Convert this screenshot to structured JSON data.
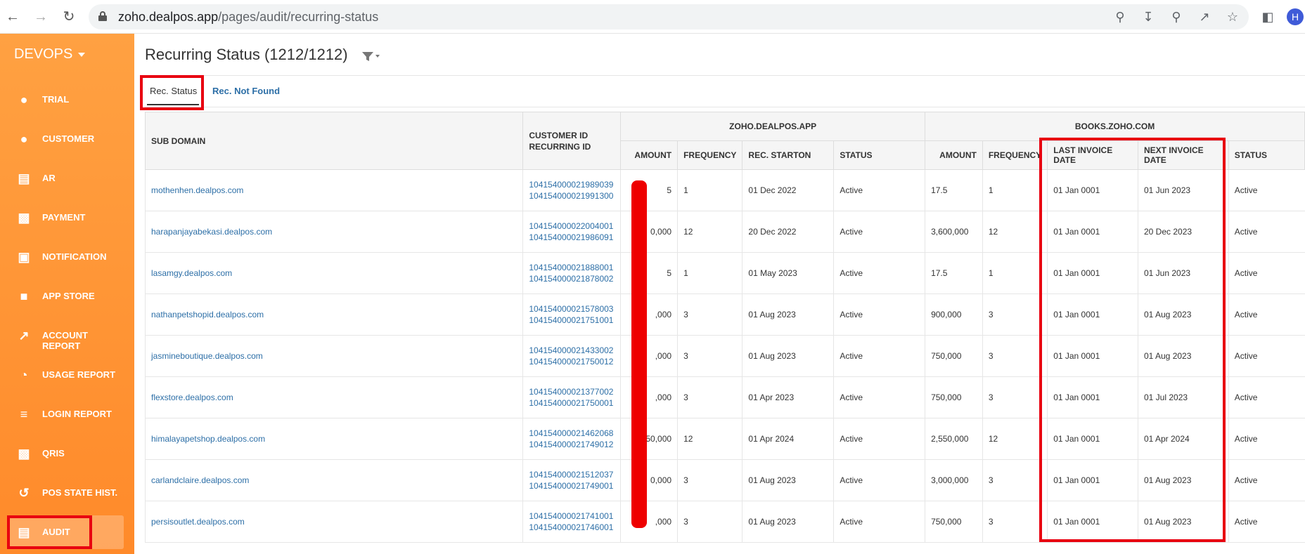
{
  "browser": {
    "url_domain": "zoho.dealpos.app",
    "url_path": "/pages/audit/recurring-status",
    "profile_initial": "H"
  },
  "sidebar": {
    "brand": "DEVOPS",
    "items": [
      {
        "label": "TRIAL",
        "icon": "person-icon"
      },
      {
        "label": "CUSTOMER",
        "icon": "person-icon"
      },
      {
        "label": "AR",
        "icon": "document-icon"
      },
      {
        "label": "PAYMENT",
        "icon": "money-icon"
      },
      {
        "label": "NOTIFICATION",
        "icon": "inbox-icon"
      },
      {
        "label": "APP STORE",
        "icon": "store-icon"
      },
      {
        "label": "ACCOUNT REPORT",
        "icon": "line-chart-icon"
      },
      {
        "label": "USAGE REPORT",
        "icon": "pie-chart-icon"
      },
      {
        "label": "LOGIN REPORT",
        "icon": "list-chart-icon"
      },
      {
        "label": "QRIS",
        "icon": "money-icon"
      },
      {
        "label": "POS STATE HIST.",
        "icon": "history-icon"
      },
      {
        "label": "AUDIT",
        "icon": "book-icon"
      }
    ],
    "active_item": "AUDIT"
  },
  "page": {
    "title": "Recurring Status (1212/1212)",
    "tabs": [
      {
        "label": "Rec. Status",
        "active": true
      },
      {
        "label": "Rec. Not Found",
        "active": false
      }
    ]
  },
  "table": {
    "group_headers": {
      "zoho": "ZOHO.DEALPOS.APP",
      "books": "BOOKS.ZOHO.COM"
    },
    "headers": {
      "sub_domain": "SUB DOMAIN",
      "customer_id": "CUSTOMER ID",
      "recurring_id": "RECURRING ID",
      "amount": "AMOUNT",
      "frequency": "FREQUENCY",
      "rec_starton": "REC. STARTON",
      "status": "STATUS",
      "books_amount": "AMOUNT",
      "books_frequency": "FREQUENCY",
      "last_invoice_date": "LAST INVOICE DATE",
      "next_invoice_date": "NEXT INVOICE DATE",
      "books_status": "STATUS"
    },
    "rows": [
      {
        "sub_domain": "mothenhen.dealpos.com",
        "customer_id": "104154000021989039",
        "recurring_id": "104154000021991300",
        "amount": "5",
        "frequency": "1",
        "rec_starton": "01 Dec 2022",
        "status": "Active",
        "books_amount": "17.5",
        "books_frequency": "1",
        "last_invoice": "01 Jan 0001",
        "next_invoice": "01 Jun 2023",
        "books_status": "Active"
      },
      {
        "sub_domain": "harapanjayabekasi.dealpos.com",
        "customer_id": "104154000022004001",
        "recurring_id": "104154000021986091",
        "amount": "0,000",
        "frequency": "12",
        "rec_starton": "20 Dec 2022",
        "status": "Active",
        "books_amount": "3,600,000",
        "books_frequency": "12",
        "last_invoice": "01 Jan 0001",
        "next_invoice": "20 Dec 2023",
        "books_status": "Active"
      },
      {
        "sub_domain": "lasamgy.dealpos.com",
        "customer_id": "104154000021888001",
        "recurring_id": "104154000021878002",
        "amount": "5",
        "frequency": "1",
        "rec_starton": "01 May 2023",
        "status": "Active",
        "books_amount": "17.5",
        "books_frequency": "1",
        "last_invoice": "01 Jan 0001",
        "next_invoice": "01 Jun 2023",
        "books_status": "Active"
      },
      {
        "sub_domain": "nathanpetshopid.dealpos.com",
        "customer_id": "104154000021578003",
        "recurring_id": "104154000021751001",
        "amount": ",000",
        "frequency": "3",
        "rec_starton": "01 Aug 2023",
        "status": "Active",
        "books_amount": "900,000",
        "books_frequency": "3",
        "last_invoice": "01 Jan 0001",
        "next_invoice": "01 Aug 2023",
        "books_status": "Active"
      },
      {
        "sub_domain": "jasmineboutique.dealpos.com",
        "customer_id": "104154000021433002",
        "recurring_id": "104154000021750012",
        "amount": ",000",
        "frequency": "3",
        "rec_starton": "01 Aug 2023",
        "status": "Active",
        "books_amount": "750,000",
        "books_frequency": "3",
        "last_invoice": "01 Jan 0001",
        "next_invoice": "01 Aug 2023",
        "books_status": "Active"
      },
      {
        "sub_domain": "flexstore.dealpos.com",
        "customer_id": "104154000021377002",
        "recurring_id": "104154000021750001",
        "amount": ",000",
        "frequency": "3",
        "rec_starton": "01 Apr 2023",
        "status": "Active",
        "books_amount": "750,000",
        "books_frequency": "3",
        "last_invoice": "01 Jan 0001",
        "next_invoice": "01 Jul 2023",
        "books_status": "Active"
      },
      {
        "sub_domain": "himalayapetshop.dealpos.com",
        "customer_id": "104154000021462068",
        "recurring_id": "104154000021749012",
        "amount": "50,000",
        "frequency": "12",
        "rec_starton": "01 Apr 2024",
        "status": "Active",
        "books_amount": "2,550,000",
        "books_frequency": "12",
        "last_invoice": "01 Jan 0001",
        "next_invoice": "01 Apr 2024",
        "books_status": "Active"
      },
      {
        "sub_domain": "carlandclaire.dealpos.com",
        "customer_id": "104154000021512037",
        "recurring_id": "104154000021749001",
        "amount": "0,000",
        "frequency": "3",
        "rec_starton": "01 Aug 2023",
        "status": "Active",
        "books_amount": "3,000,000",
        "books_frequency": "3",
        "last_invoice": "01 Jan 0001",
        "next_invoice": "01 Aug 2023",
        "books_status": "Active"
      },
      {
        "sub_domain": "persisoutlet.dealpos.com",
        "customer_id": "104154000021741001",
        "recurring_id": "104154000021746001",
        "amount": ",000",
        "frequency": "3",
        "rec_starton": "01 Aug 2023",
        "status": "Active",
        "books_amount": "750,000",
        "books_frequency": "3",
        "last_invoice": "01 Jan 0001",
        "next_invoice": "01 Aug 2023",
        "books_status": "Active"
      }
    ]
  },
  "colors": {
    "sidebar": "#ff9633",
    "link": "#2d6fa7",
    "highlight": "#e80010",
    "redaction": "#ee0000"
  }
}
